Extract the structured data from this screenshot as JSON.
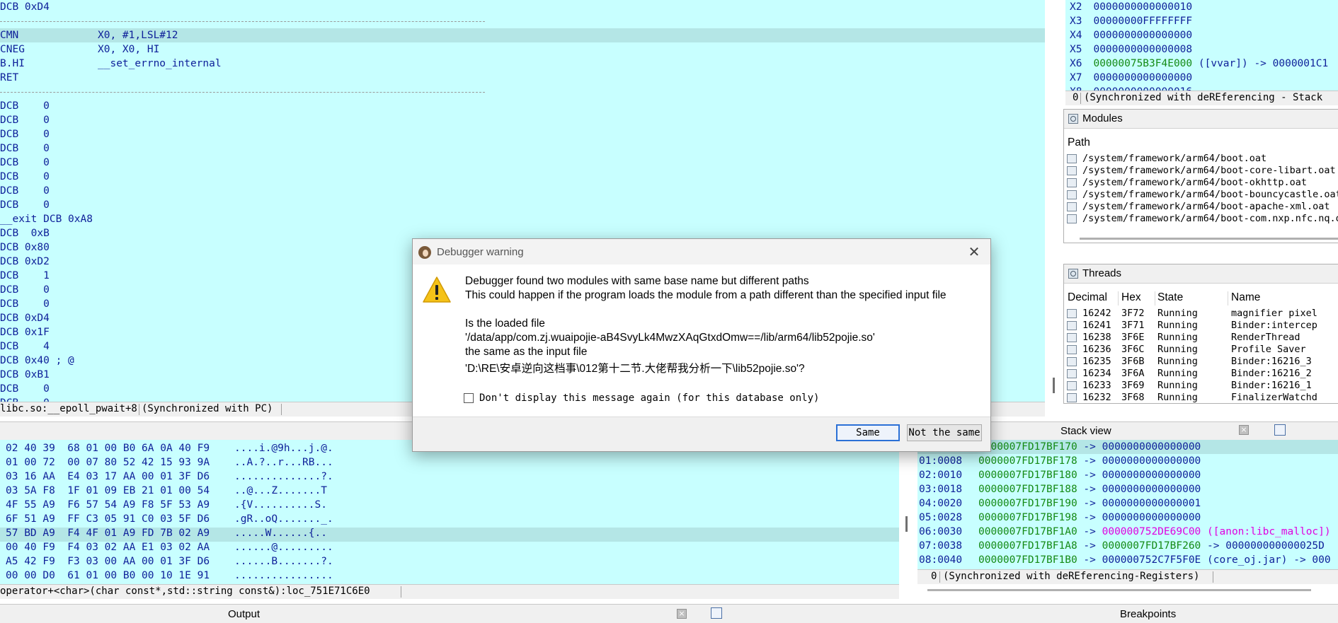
{
  "disasm": {
    "lines": [
      {
        "op": "DCB 0xD4",
        "arg": "",
        "cls": ""
      },
      {
        "op": "",
        "arg": "",
        "cls": "sep"
      },
      {
        "op": "CMN",
        "arg": "X0, #1,LSL#12",
        "cls": "hl"
      },
      {
        "op": "CNEG",
        "arg": "X0, X0, HI",
        "cls": ""
      },
      {
        "op": "B.HI",
        "arg": "__set_errno_internal",
        "cls": ""
      },
      {
        "op": "RET",
        "arg": "",
        "cls": ""
      },
      {
        "op": "",
        "arg": "",
        "cls": "sep"
      },
      {
        "op": "DCB    0",
        "arg": "",
        "cls": ""
      },
      {
        "op": "DCB    0",
        "arg": "",
        "cls": ""
      },
      {
        "op": "DCB    0",
        "arg": "",
        "cls": ""
      },
      {
        "op": "DCB    0",
        "arg": "",
        "cls": ""
      },
      {
        "op": "DCB    0",
        "arg": "",
        "cls": ""
      },
      {
        "op": "DCB    0",
        "arg": "",
        "cls": ""
      },
      {
        "op": "DCB    0",
        "arg": "",
        "cls": ""
      },
      {
        "op": "DCB    0",
        "arg": "",
        "cls": ""
      },
      {
        "op": "__exit DCB 0xA8",
        "arg": "",
        "cls": ""
      },
      {
        "op": "DCB  0xB",
        "arg": "",
        "cls": ""
      },
      {
        "op": "DCB 0x80",
        "arg": "",
        "cls": ""
      },
      {
        "op": "DCB 0xD2",
        "arg": "",
        "cls": ""
      },
      {
        "op": "DCB    1",
        "arg": "",
        "cls": ""
      },
      {
        "op": "DCB    0",
        "arg": "",
        "cls": ""
      },
      {
        "op": "DCB    0",
        "arg": "",
        "cls": ""
      },
      {
        "op": "DCB 0xD4",
        "arg": "",
        "cls": ""
      },
      {
        "op": "DCB 0x1F",
        "arg": "",
        "cls": ""
      },
      {
        "op": "DCB    4",
        "arg": "",
        "cls": ""
      },
      {
        "op": "DCB 0x40 ; @",
        "arg": "",
        "cls": ""
      },
      {
        "op": "DCB 0xB1",
        "arg": "",
        "cls": ""
      },
      {
        "op": "DCB    0",
        "arg": "",
        "cls": ""
      },
      {
        "op": "DCB    0",
        "arg": "",
        "cls": ""
      }
    ],
    "status_location": "libc.so:__epoll_pwait+8",
    "status_sync": "(Synchronized with PC)"
  },
  "registers": {
    "rows": [
      {
        "name": "X2",
        "value": "0000000000000010",
        "extra": ""
      },
      {
        "name": "X3",
        "value": "00000000FFFFFFFF",
        "extra": ""
      },
      {
        "name": "X4",
        "value": "0000000000000000",
        "extra": ""
      },
      {
        "name": "X5",
        "value": "0000000000000008",
        "extra": ""
      },
      {
        "name": "X6",
        "value": "00000075B3F4E000",
        "extra": " ([vvar]) -> 0000001C1"
      },
      {
        "name": "X7",
        "value": "0000000000000000",
        "extra": ""
      },
      {
        "name": "X8",
        "value": "0000000000000016",
        "extra": ""
      }
    ],
    "status": "(Synchronized with deREferencing - Stack"
  },
  "modules": {
    "title": "Modules",
    "column": "Path",
    "items": [
      "/system/framework/arm64/boot.oat",
      "/system/framework/arm64/boot-core-libart.oat",
      "/system/framework/arm64/boot-okhttp.oat",
      "/system/framework/arm64/boot-bouncycastle.oat",
      "/system/framework/arm64/boot-apache-xml.oat",
      "/system/framework/arm64/boot-com.nxp.nfc.nq.o"
    ]
  },
  "threads": {
    "title": "Threads",
    "columns": [
      "Decimal",
      "Hex",
      "State",
      "Name"
    ],
    "rows": [
      [
        "16242",
        "3F72",
        "Running",
        "magnifier pixel"
      ],
      [
        "16241",
        "3F71",
        "Running",
        "Binder:intercep"
      ],
      [
        "16238",
        "3F6E",
        "Running",
        "RenderThread"
      ],
      [
        "16236",
        "3F6C",
        "Running",
        "Profile Saver"
      ],
      [
        "16235",
        "3F6B",
        "Running",
        "Binder:16216_3"
      ],
      [
        "16234",
        "3F6A",
        "Running",
        "Binder:16216_2"
      ],
      [
        "16233",
        "3F69",
        "Running",
        "Binder:16216_1"
      ],
      [
        "16232",
        "3F68",
        "Running",
        "FinalizerWatchd"
      ]
    ]
  },
  "hex": {
    "rows": [
      {
        "bytes": "02 40 39  68 01 00 B0 6A 0A 40 F9",
        "ascii": "....i.@9h...j.@."
      },
      {
        "bytes": "01 00 72  00 07 80 52 42 15 93 9A",
        "ascii": "..A.?..r...RB..."
      },
      {
        "bytes": "03 16 AA  E4 03 17 AA 00 01 3F D6",
        "ascii": "..............?."
      },
      {
        "bytes": "03 5A F8  1F 01 09 EB 21 01 00 54",
        "ascii": "..@...Z.......T"
      },
      {
        "bytes": "4F 55 A9  F6 57 54 A9 F8 5F 53 A9",
        "ascii": ".{V..........S."
      },
      {
        "bytes": "6F 51 A9  FF C3 05 91 C0 03 5F D6",
        "ascii": ".gR..oQ......._."
      },
      {
        "bytes": "57 BD A9  F4 4F 01 A9 FD 7B 02 A9",
        "ascii": ".....W......{.."
      },
      {
        "bytes": "00 40 F9  F4 03 02 AA E1 03 02 AA",
        "ascii": "......@........."
      },
      {
        "bytes": "A5 42 F9  F3 03 00 AA 00 01 3F D6",
        "ascii": "......B.......?."
      },
      {
        "bytes": "00 00 D0  61 01 00 B0 00 10 1E 91",
        "ascii": "................"
      }
    ],
    "status": "operator+<char>(char const*,std::string const&):loc_751E71C6E0"
  },
  "stack": {
    "title": "Stack view",
    "rows": [
      {
        "idx": "",
        "addr": "0000007FD17BF170",
        "arrow": " -> ",
        "val": "0000000000000000",
        "vcls": "",
        "note": "",
        "ncls": ""
      },
      {
        "idx": "01:0008",
        "addr": "0000007FD17BF178",
        "arrow": " -> ",
        "val": "0000000000000000",
        "vcls": "",
        "note": "",
        "ncls": ""
      },
      {
        "idx": "02:0010",
        "addr": "0000007FD17BF180",
        "arrow": " -> ",
        "val": "0000000000000000",
        "vcls": "",
        "note": "",
        "ncls": ""
      },
      {
        "idx": "03:0018",
        "addr": "0000007FD17BF188",
        "arrow": " -> ",
        "val": "0000000000000000",
        "vcls": "",
        "note": "",
        "ncls": ""
      },
      {
        "idx": "04:0020",
        "addr": "0000007FD17BF190",
        "arrow": " -> ",
        "val": "0000000000000001",
        "vcls": "",
        "note": "",
        "ncls": ""
      },
      {
        "idx": "05:0028",
        "addr": "0000007FD17BF198",
        "arrow": " -> ",
        "val": "0000000000000000",
        "vcls": "",
        "note": "",
        "ncls": ""
      },
      {
        "idx": "06:0030",
        "addr": "0000007FD17BF1A0",
        "arrow": " -> ",
        "val": "000000752DE69C00",
        "vcls": "mag",
        "note": " ([anon:libc_malloc])",
        "ncls": "mag"
      },
      {
        "idx": "07:0038",
        "addr": "0000007FD17BF1A8",
        "arrow": " -> ",
        "val": "0000007FD17BF260",
        "vcls": "grn",
        "note": " -> 000000000000025D",
        "ncls": ""
      },
      {
        "idx": "08:0040",
        "addr": "0000007FD17BF1B0",
        "arrow": " -> ",
        "val": "000000752C7F5F0E",
        "vcls": "",
        "note": " (core_oj.jar) -> 000",
        "ncls": ""
      }
    ],
    "status_index": "0",
    "status": "(Synchronized with deREferencing-Registers)"
  },
  "tabs": {
    "output": "Output",
    "breakpoints": "Breakpoints"
  },
  "dialog": {
    "title": "Debugger warning",
    "line1": "Debugger found two modules with same base name but different paths",
    "line2": "This could happen if the program loads the module from a path different than the specified input file",
    "line3": "Is the loaded file",
    "line4": "'/data/app/com.zj.wuaipojie-aB4SvyLk4MwzXAqGtxdOmw==/lib/arm64/lib52pojie.so'",
    "line5": "the same as the input file",
    "line6": "'D:\\RE\\安卓逆向这档事\\012第十二节.大佬帮我分析一下\\lib52pojie.so'?",
    "checkbox": "Don't display this message again (for this database only)",
    "btn_same": "Same",
    "btn_not_same": "Not the same"
  }
}
